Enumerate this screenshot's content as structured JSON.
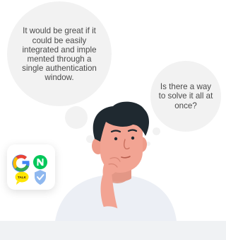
{
  "bubbles": {
    "left": "It would be great if it could be easily integrated and imple mented through a single authentication window.",
    "right": "Is there a way to solve it all at once?"
  },
  "login_icons": {
    "google": {
      "letter": "G",
      "colors": [
        "#4285f4",
        "#ea4335",
        "#fbbc05",
        "#34a853"
      ]
    },
    "naver": {
      "letter": "N",
      "color": "#03c75a"
    },
    "kakao": {
      "label": "TALK",
      "color": "#fee500"
    },
    "shield_color": "#8fb8ef"
  },
  "colors": {
    "bubble": "#f2f2f2",
    "hair": "#1f2930",
    "skin": "#f2a493",
    "shirt": "#eceff5"
  }
}
